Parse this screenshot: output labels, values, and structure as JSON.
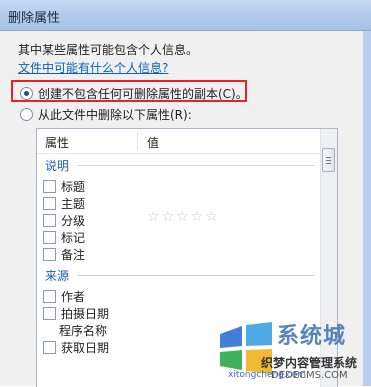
{
  "window": {
    "title": "删除属性"
  },
  "info": {
    "text": "其中某些属性可能包含个人信息。",
    "link": "文件中可能有什么个人信息?"
  },
  "options": [
    {
      "label": "创建不包含任何可删除属性的副本(C)。",
      "selected": true
    },
    {
      "label": "从此文件中删除以下属性(R):",
      "selected": false
    }
  ],
  "list": {
    "columns": [
      "属性",
      "值"
    ],
    "groups": [
      {
        "name": "说明",
        "items": [
          "标题",
          "主题",
          "分级",
          "标记",
          "备注"
        ]
      },
      {
        "name": "来源",
        "items": [
          "作者",
          "拍摄日期",
          "程序名称",
          "获取日期"
        ]
      }
    ],
    "rating_stars": "☆☆☆☆☆"
  },
  "watermark": {
    "main": "系统城",
    "sub1": "织梦内容管理系统",
    "sub2": "DEDECMS.COM",
    "url": "xitongcheng.com"
  },
  "colors": {
    "accent_link": "#0a62b8",
    "highlight_border": "#e0262a",
    "group_header": "#1f5fa8"
  }
}
